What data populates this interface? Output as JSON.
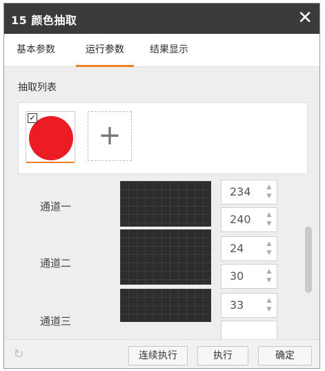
{
  "window": {
    "title": "15 颜色抽取",
    "close_glyph": "✕"
  },
  "tabs": [
    {
      "label": "基本参数",
      "active": false
    },
    {
      "label": "运行参数",
      "active": true
    },
    {
      "label": "结果显示",
      "active": false
    }
  ],
  "extract_list": {
    "title": "抽取列表",
    "items": [
      {
        "color": "#ec1c24",
        "checked": true,
        "check_glyph": "✓"
      }
    ],
    "add_glyph": "+"
  },
  "channels": [
    {
      "label": "通道一",
      "min": "234",
      "max": "240"
    },
    {
      "label": "通道二",
      "min": "24",
      "max": "30"
    },
    {
      "label": "通道三",
      "min": "33",
      "max": ""
    }
  ],
  "spin_arrows": {
    "up": "▲",
    "down": "▼"
  },
  "footer": {
    "refresh_icon": "↻",
    "buttons": {
      "continuous": "连续执行",
      "execute": "执行",
      "confirm": "确定"
    }
  },
  "colors": {
    "titlebar": "#3a3a3a",
    "accent": "#ef7d22",
    "swatch_red": "#ec1c24",
    "histogram_bg": "#2d2d2d"
  }
}
